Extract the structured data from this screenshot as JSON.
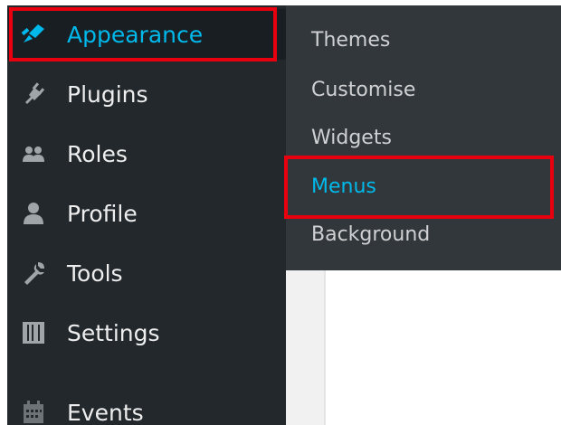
{
  "sidebar": {
    "items": [
      {
        "label": "Appearance",
        "icon": "paintbrush-icon",
        "current": true
      },
      {
        "label": "Plugins",
        "icon": "plug-icon"
      },
      {
        "label": "Roles",
        "icon": "users-icon"
      },
      {
        "label": "Profile",
        "icon": "user-icon"
      },
      {
        "label": "Tools",
        "icon": "wrench-icon"
      },
      {
        "label": "Settings",
        "icon": "sliders-icon"
      },
      {
        "label": "Events",
        "icon": "calendar-icon"
      }
    ]
  },
  "submenu": {
    "items": [
      {
        "label": "Themes"
      },
      {
        "label": "Customise"
      },
      {
        "label": "Widgets"
      },
      {
        "label": "Menus",
        "current": true
      },
      {
        "label": "Background"
      }
    ]
  },
  "colors": {
    "sidebar_bg": "#23282d",
    "submenu_bg": "#32373c",
    "accent": "#00b9eb",
    "highlight": "#e8000e"
  }
}
